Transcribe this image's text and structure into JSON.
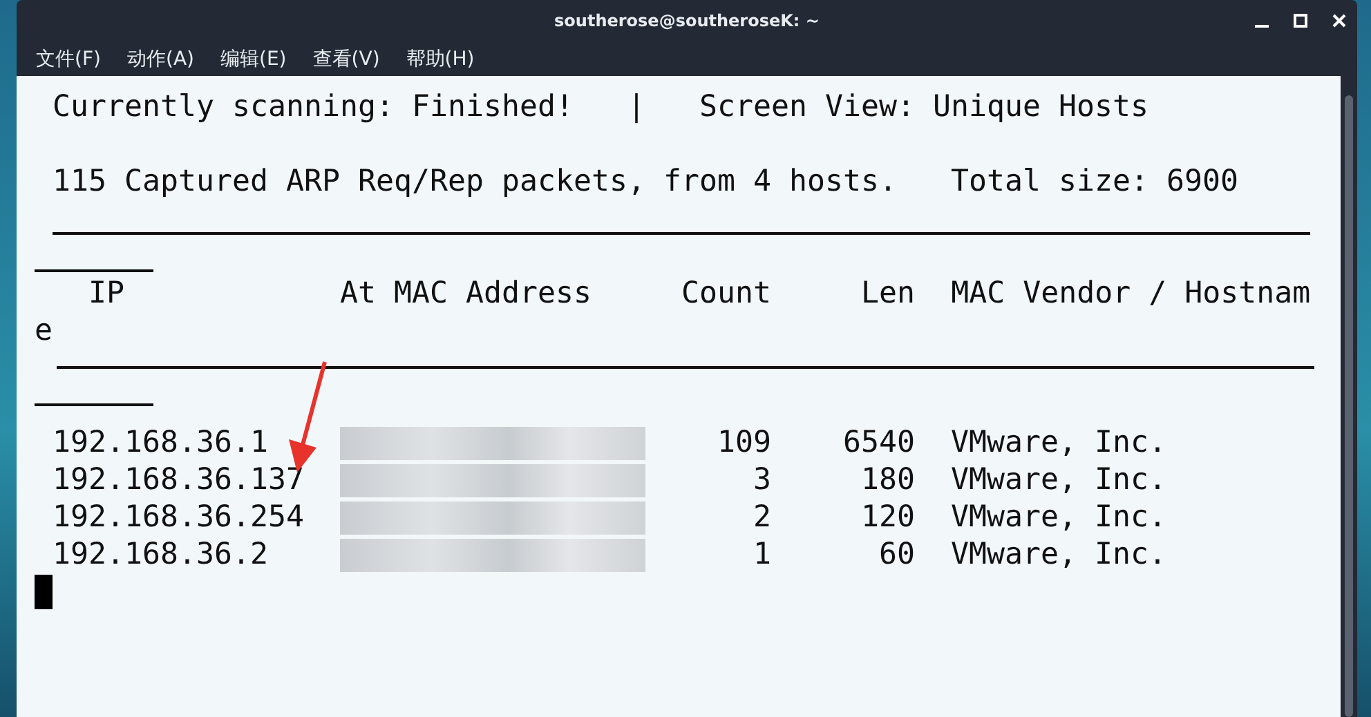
{
  "window": {
    "title": "southerose@southeroseK: ~"
  },
  "menu": [
    "文件(F)",
    "动作(A)",
    "编辑(E)",
    "查看(V)",
    "帮助(H)"
  ],
  "terminal": {
    "status": {
      "scanning": "Currently scanning: Finished!",
      "separator": "|",
      "view": "Screen View: Unique Hosts"
    },
    "summary": {
      "packets": "115 Captured ARP Req/Rep packets, from 4 hosts.",
      "total": "Total size: 6900"
    },
    "columns": [
      "IP",
      "At MAC Address",
      "Count",
      "Len",
      "MAC Vendor / Hostnam"
    ],
    "column_wrap": "e",
    "rows": [
      {
        "ip": "192.168.36.1",
        "count": "109",
        "len": "6540",
        "vendor": "VMware, Inc."
      },
      {
        "ip": "192.168.36.137",
        "count": "3",
        "len": "180",
        "vendor": "VMware, Inc."
      },
      {
        "ip": "192.168.36.254",
        "count": "2",
        "len": "120",
        "vendor": "VMware, Inc."
      },
      {
        "ip": "192.168.36.2",
        "count": "1",
        "len": "60",
        "vendor": "VMware, Inc."
      }
    ]
  }
}
